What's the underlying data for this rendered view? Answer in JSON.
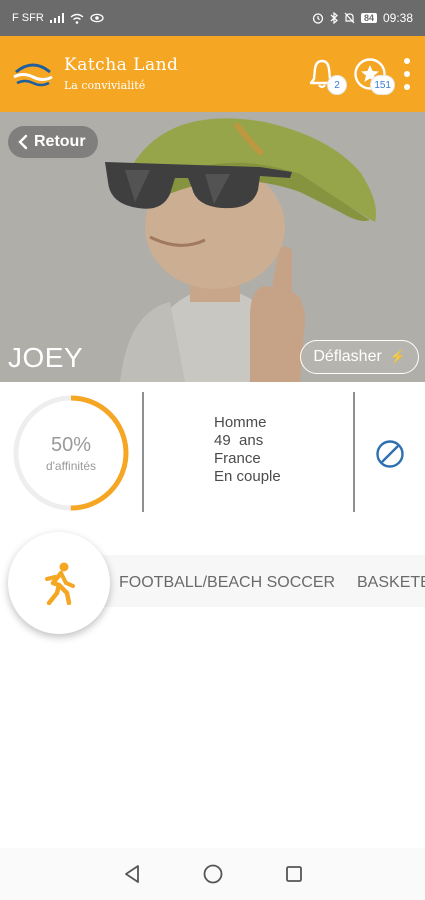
{
  "status_bar": {
    "carrier": "F SFR",
    "battery": "84",
    "time": "09:38"
  },
  "header": {
    "title": "Katcha Land",
    "subtitle": "La convivialité",
    "notifications_count": "2",
    "favorites_count": "151",
    "icons": [
      "logo-icon",
      "bell-icon",
      "star-icon",
      "more-vertical-icon"
    ]
  },
  "hero": {
    "back_label": "Retour",
    "name": "JOEY",
    "deflash_label": "Déflasher",
    "deflash_symbol": "⚡"
  },
  "profile": {
    "affinity_percent": "50%",
    "affinity_value": 0.5,
    "affinity_label": "d'affinités",
    "gender": "Homme",
    "age": "49  ans",
    "country": "France",
    "status": "En couple"
  },
  "activities": {
    "icon": "running-person-icon",
    "items": [
      "FOOTBALL/BEACH SOCCER",
      "BASKETE"
    ]
  },
  "colors": {
    "accent": "#f5a623",
    "block_icon": "#2d6fb1"
  }
}
